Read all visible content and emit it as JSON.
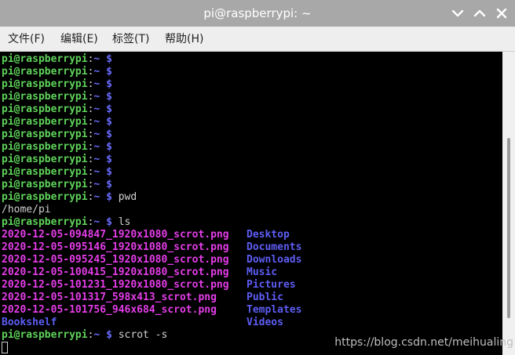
{
  "window": {
    "title": "pi@raspberrypi: ~",
    "icons": {
      "close": "close-chevron-icon",
      "minimize": "chevron-up-icon",
      "maximize": "close-x-icon"
    }
  },
  "menubar": [
    {
      "label": "文件(F)"
    },
    {
      "label": "编辑(E)"
    },
    {
      "label": "标签(T)"
    },
    {
      "label": "帮助(H)"
    }
  ],
  "terminal": {
    "user": "pi@raspberrypi",
    "sep": ":",
    "path": "~",
    "dollar": "$",
    "cmd_pwd": "pwd",
    "pwd_output": "/home/pi",
    "cmd_ls": "ls",
    "ls_rows": [
      {
        "file": "2020-12-05-094847_1920x1080_scrot.png",
        "dir": "Desktop"
      },
      {
        "file": "2020-12-05-095146_1920x1080_scrot.png",
        "dir": "Documents"
      },
      {
        "file": "2020-12-05-095245_1920x1080_scrot.png",
        "dir": "Downloads"
      },
      {
        "file": "2020-12-05-100415_1920x1080_scrot.png",
        "dir": "Music"
      },
      {
        "file": "2020-12-05-101231_1920x1080_scrot.png",
        "dir": "Pictures"
      },
      {
        "file": "2020-12-05-101317_598x413_scrot.png",
        "dir": "Public"
      },
      {
        "file": "2020-12-05-101756_946x684_scrot.png",
        "dir": "Templates"
      },
      {
        "file": "",
        "dir": "Videos"
      }
    ],
    "extra_dir": "Bookshelf",
    "cmd_last": "scrot -s"
  },
  "watermark": "https://blog.csdn.net/meihualing",
  "colors": {
    "titlebar": "#a8a8a8",
    "menubar": "#eeeeee",
    "terminal_bg": "#000000",
    "prompt_user": "#5fd35a",
    "prompt_dollar": "#6a6cff",
    "file_color": "#e43de8",
    "dir_color": "#5d5df5"
  }
}
